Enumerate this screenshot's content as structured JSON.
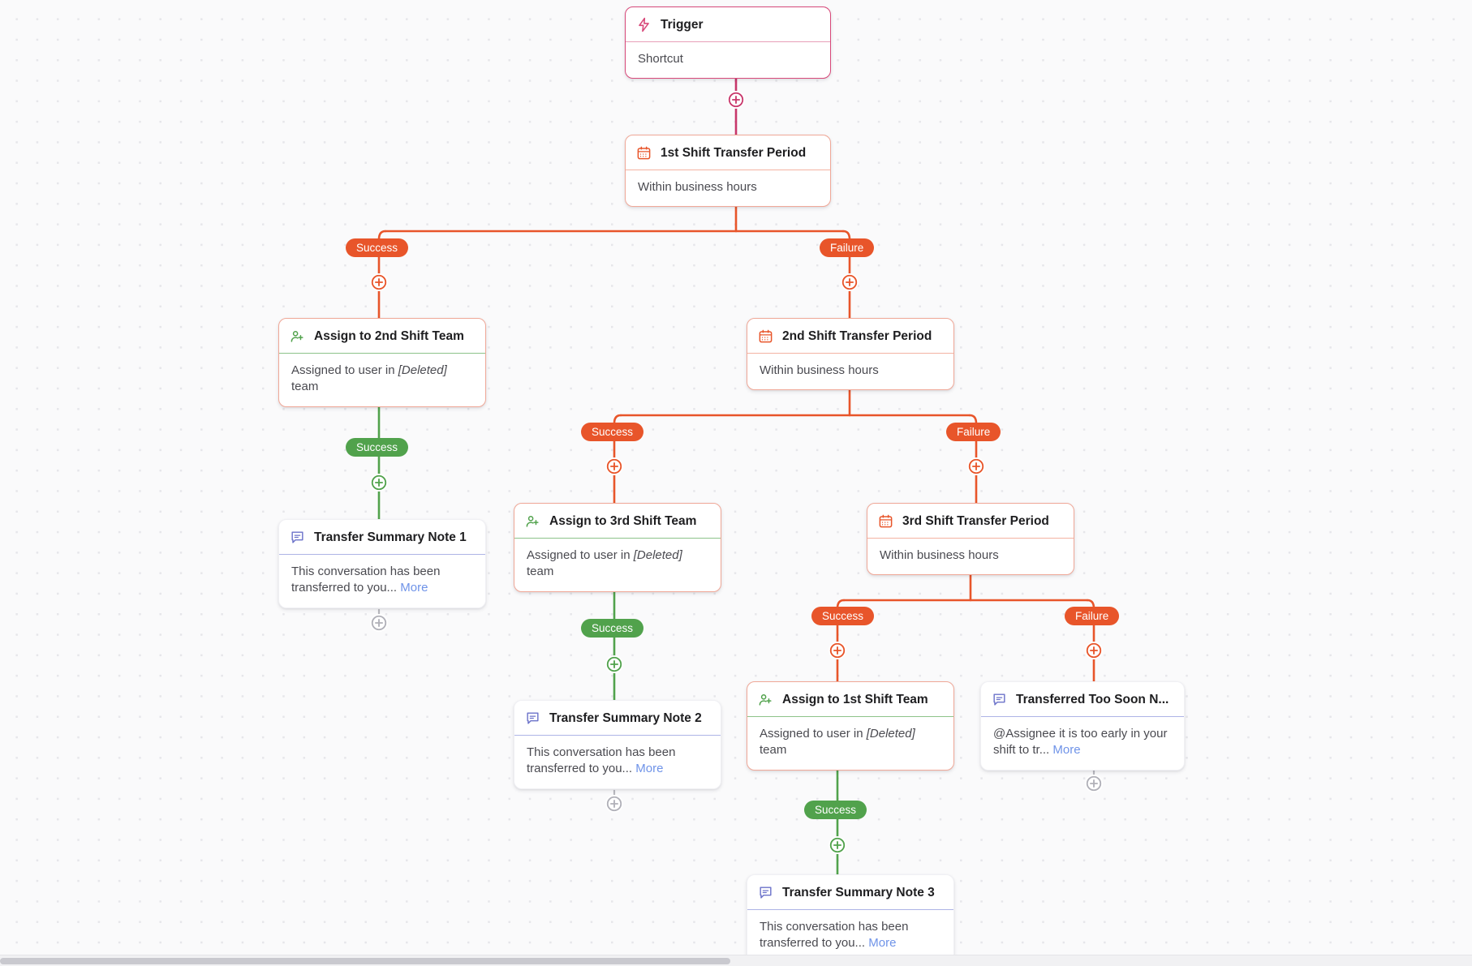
{
  "canvas": {
    "background_color": "#fafafb",
    "dot_color": "#e6e6ea"
  },
  "colors": {
    "orange": "#e8552a",
    "orange_border": "#f0a898",
    "green": "#51a24c",
    "green_border": "#8dc38a",
    "crimson": "#d8497a",
    "purple": "#6b72c9",
    "purple_border": "#aeb4e6",
    "link_blue": "#6f93e8",
    "dashed_gray": "#b8b8be"
  },
  "nodes": [
    {
      "id": "trigger",
      "kind": "trigger",
      "icon": "lightning-bolt-icon",
      "title": "Trigger",
      "body": "Shortcut"
    },
    {
      "id": "cond1",
      "kind": "condition",
      "icon": "calendar-icon",
      "title": "1st Shift Transfer Period",
      "body": "Within business hours"
    },
    {
      "id": "assign2",
      "kind": "assign",
      "icon": "assign-user-icon",
      "title": "Assign to 2nd Shift Team",
      "body_prefix": "Assigned to user in ",
      "body_italic": "[Deleted]",
      "body_suffix": " team"
    },
    {
      "id": "cond2",
      "kind": "condition",
      "icon": "calendar-icon",
      "title": "2nd Shift Transfer Period",
      "body": "Within business hours"
    },
    {
      "id": "note1",
      "kind": "note",
      "icon": "note-icon",
      "title": "Transfer Summary Note 1",
      "body_text": "This conversation has been transferred to you...",
      "body_link": "More"
    },
    {
      "id": "assign3",
      "kind": "assign",
      "icon": "assign-user-icon",
      "title": "Assign to 3rd Shift Team",
      "body_prefix": "Assigned to user in ",
      "body_italic": "[Deleted]",
      "body_suffix": " team"
    },
    {
      "id": "cond3",
      "kind": "condition",
      "icon": "calendar-icon",
      "title": "3rd Shift Transfer Period",
      "body": "Within business hours"
    },
    {
      "id": "note2",
      "kind": "note",
      "icon": "note-icon",
      "title": "Transfer Summary Note 2",
      "body_text": "This conversation has been transferred to you...",
      "body_link": "More"
    },
    {
      "id": "assign1",
      "kind": "assign",
      "icon": "assign-user-icon",
      "title": "Assign to 1st Shift Team",
      "body_prefix": "Assigned to user in ",
      "body_italic": "[Deleted]",
      "body_suffix": " team"
    },
    {
      "id": "note_soon",
      "kind": "note",
      "icon": "note-icon",
      "title": "Transferred Too Soon N...",
      "body_text": "@Assignee it is too early in your shift to tr...",
      "body_link": "More"
    },
    {
      "id": "note3",
      "kind": "note",
      "icon": "note-icon",
      "title": "Transfer Summary Note 3",
      "body_text": "This conversation has been transferred to you...",
      "body_link": "More"
    }
  ],
  "branch_labels": {
    "cond1_success": "Success",
    "cond1_failure": "Failure",
    "assign2_success": "Success",
    "cond2_success": "Success",
    "cond2_failure": "Failure",
    "assign3_success": "Success",
    "cond3_success": "Success",
    "cond3_failure": "Failure",
    "assign1_success": "Success"
  },
  "add_buttons": {
    "label": "add-step"
  }
}
